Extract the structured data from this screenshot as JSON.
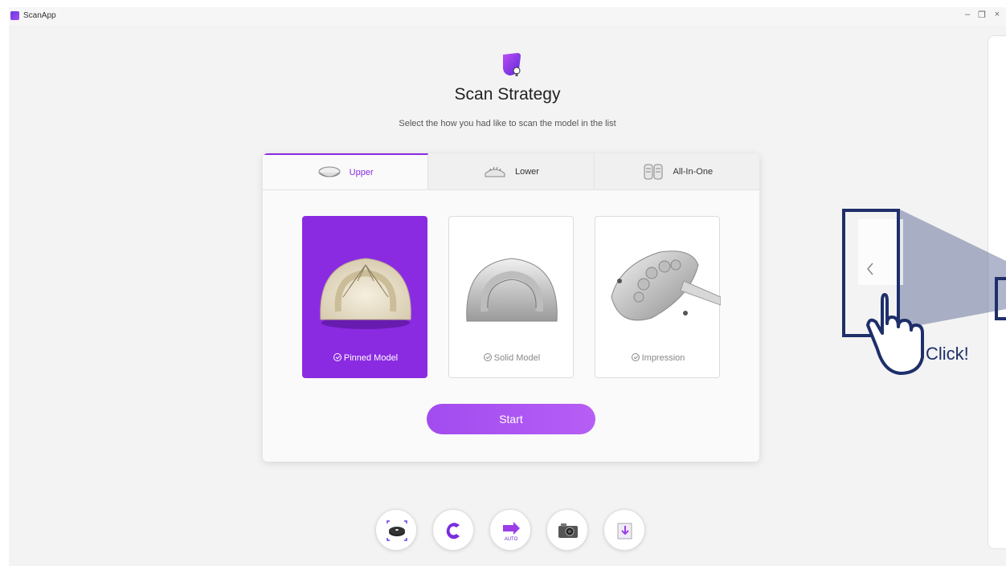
{
  "window": {
    "app_name": "ScanApp",
    "controls": {
      "minimize": "–",
      "restore": "❐",
      "close": "×"
    }
  },
  "header": {
    "title": "Scan Strategy",
    "subtitle": "Select the how you had like to scan the model in the list"
  },
  "tabs": [
    {
      "label": "Upper",
      "active": true
    },
    {
      "label": "Lower",
      "active": false
    },
    {
      "label": "All-In-One",
      "active": false
    }
  ],
  "options": [
    {
      "label": "Pinned Model",
      "selected": true
    },
    {
      "label": "Solid Model",
      "selected": false
    },
    {
      "label": "Impression",
      "selected": false
    }
  ],
  "start_button": {
    "label": "Start"
  },
  "toolbar": {
    "tools": [
      {
        "icon": "turntable-scan-icon"
      },
      {
        "icon": "calibration-icon"
      },
      {
        "icon": "auto-scan-icon"
      },
      {
        "icon": "camera-icon"
      },
      {
        "icon": "export-icon"
      }
    ]
  },
  "annotation": {
    "text": "Click!"
  },
  "colors": {
    "accent": "#8a2be2",
    "annotation": "#1e2f6a"
  }
}
